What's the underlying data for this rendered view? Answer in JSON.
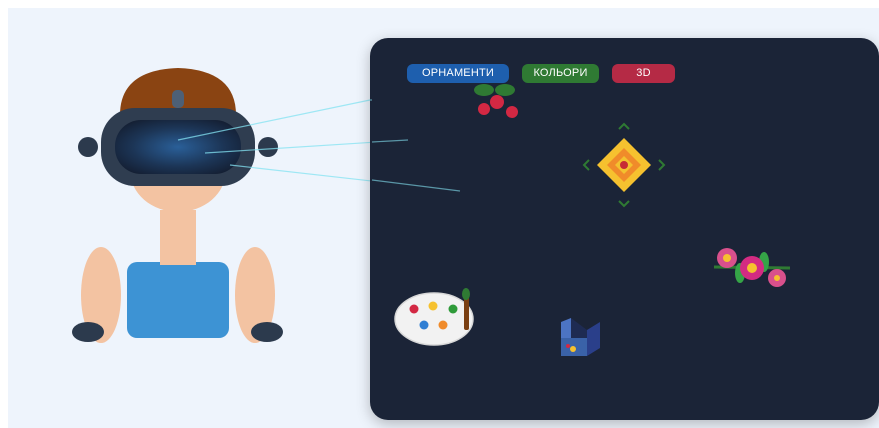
{
  "header": {
    "cutoff_text": ""
  },
  "tabs": [
    {
      "id": "ornaments",
      "label": "ОРНАМЕНТИ",
      "color": "#1e5fae"
    },
    {
      "id": "colors",
      "label": "КОЛЬОРИ",
      "color": "#2f7a33"
    },
    {
      "id": "three_d",
      "label": "3D",
      "color": "#b52a45"
    }
  ],
  "icons": [
    "vr-headset-icon",
    "berries-icon",
    "rhombus-ornament-icon",
    "flower-branch-icon",
    "palette-icon",
    "3d-cube-icon"
  ],
  "colors": {
    "panel": "#1b2437",
    "stage": "#eef5fd"
  }
}
